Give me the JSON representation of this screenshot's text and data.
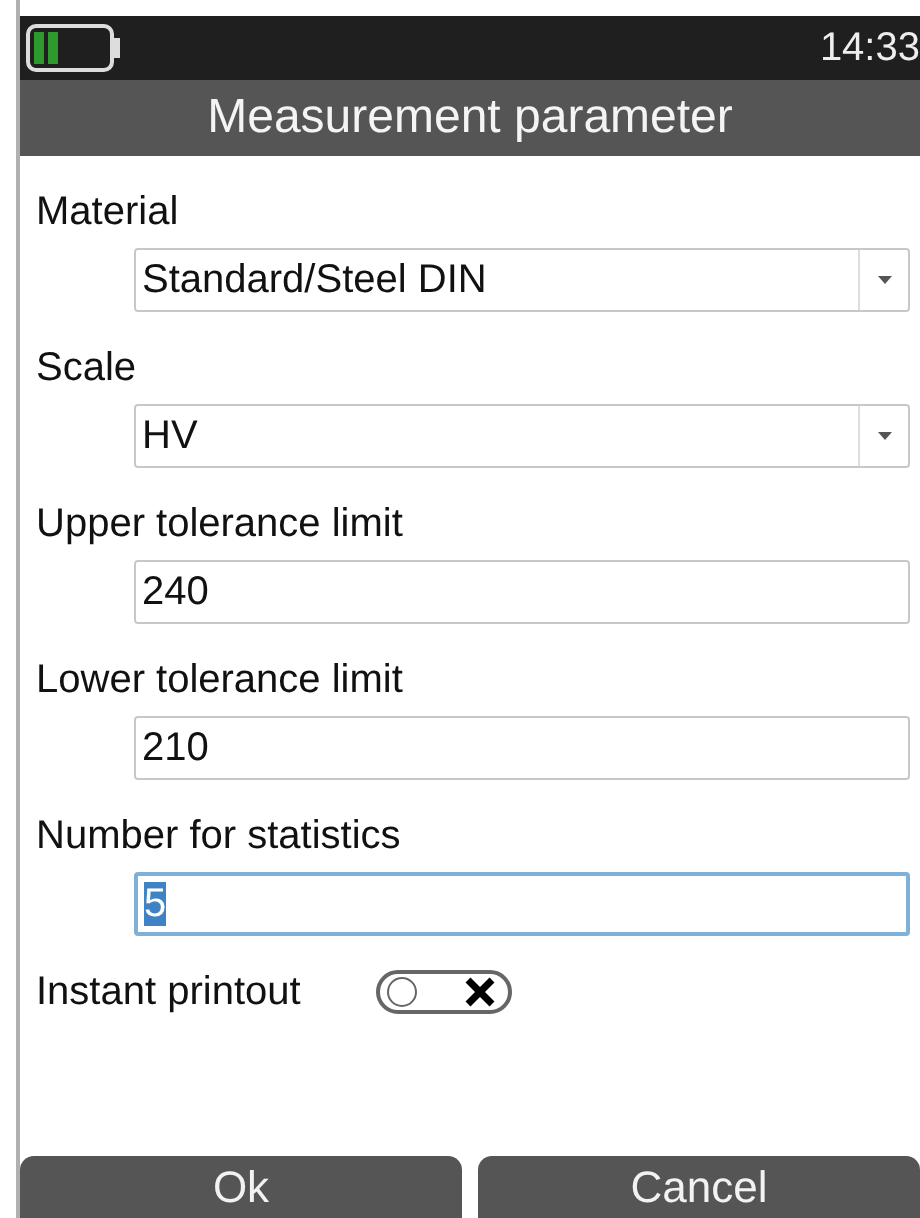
{
  "status_bar": {
    "time": "14:33"
  },
  "title": "Measurement parameter",
  "fields": [
    {
      "label": "Material",
      "kind": "select",
      "value": "Standard/Steel DIN",
      "focused": false
    },
    {
      "label": "Scale",
      "kind": "select",
      "value": "HV",
      "focused": false
    },
    {
      "label": "Upper tolerance limit",
      "kind": "input",
      "value": "240",
      "focused": false
    },
    {
      "label": "Lower tolerance limit",
      "kind": "input",
      "value": "210",
      "focused": false
    },
    {
      "label": "Number for statistics",
      "kind": "input",
      "value": "5",
      "focused": true
    }
  ],
  "instant_printout": {
    "label": "Instant printout",
    "checked": false
  },
  "buttons": [
    "Ok",
    "Cancel"
  ]
}
